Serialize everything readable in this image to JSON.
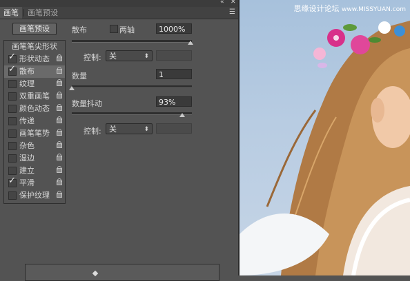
{
  "tabs": [
    {
      "label": "画笔",
      "active": true
    },
    {
      "label": "画笔预设",
      "active": false
    }
  ],
  "topbar": {
    "collapse_glyph": "«",
    "close_glyph": "✕",
    "menu_glyph": "☰"
  },
  "preset_button": {
    "label": "画笔预设"
  },
  "sidebar": {
    "header": "画笔笔尖形状",
    "items": [
      {
        "label": "形状动态",
        "checked": true,
        "active": false
      },
      {
        "label": "散布",
        "checked": true,
        "active": true
      },
      {
        "label": "纹理",
        "checked": false,
        "active": false
      },
      {
        "label": "双重画笔",
        "checked": false,
        "active": false
      },
      {
        "label": "颜色动态",
        "checked": false,
        "active": false
      },
      {
        "label": "传递",
        "checked": false,
        "active": false
      },
      {
        "label": "画笔笔势",
        "checked": false,
        "active": false
      },
      {
        "label": "杂色",
        "checked": false,
        "active": false
      },
      {
        "label": "湿边",
        "checked": false,
        "active": false
      },
      {
        "label": "建立",
        "checked": false,
        "active": false
      },
      {
        "label": "平滑",
        "checked": true,
        "active": false
      },
      {
        "label": "保护纹理",
        "checked": false,
        "active": false
      }
    ]
  },
  "scatter": {
    "label": "散布",
    "both_axes_label": "两轴",
    "both_axes_checked": false,
    "value": "1000%",
    "slider_fraction": 1.0,
    "control_label": "控制:",
    "control_value": "关"
  },
  "count": {
    "label": "数量",
    "value": "1",
    "slider_fraction": 0.0
  },
  "count_jitter": {
    "label": "数量抖动",
    "value": "93%",
    "slider_fraction": 0.93,
    "control_label": "控制:",
    "control_value": "关"
  },
  "watermark": {
    "text": "思缘设计论坛",
    "url": "www.MISSYUAN.com"
  },
  "colors": {
    "panel": "#535353",
    "field": "#3a3a3a",
    "active_item": "#6a6a6a"
  }
}
